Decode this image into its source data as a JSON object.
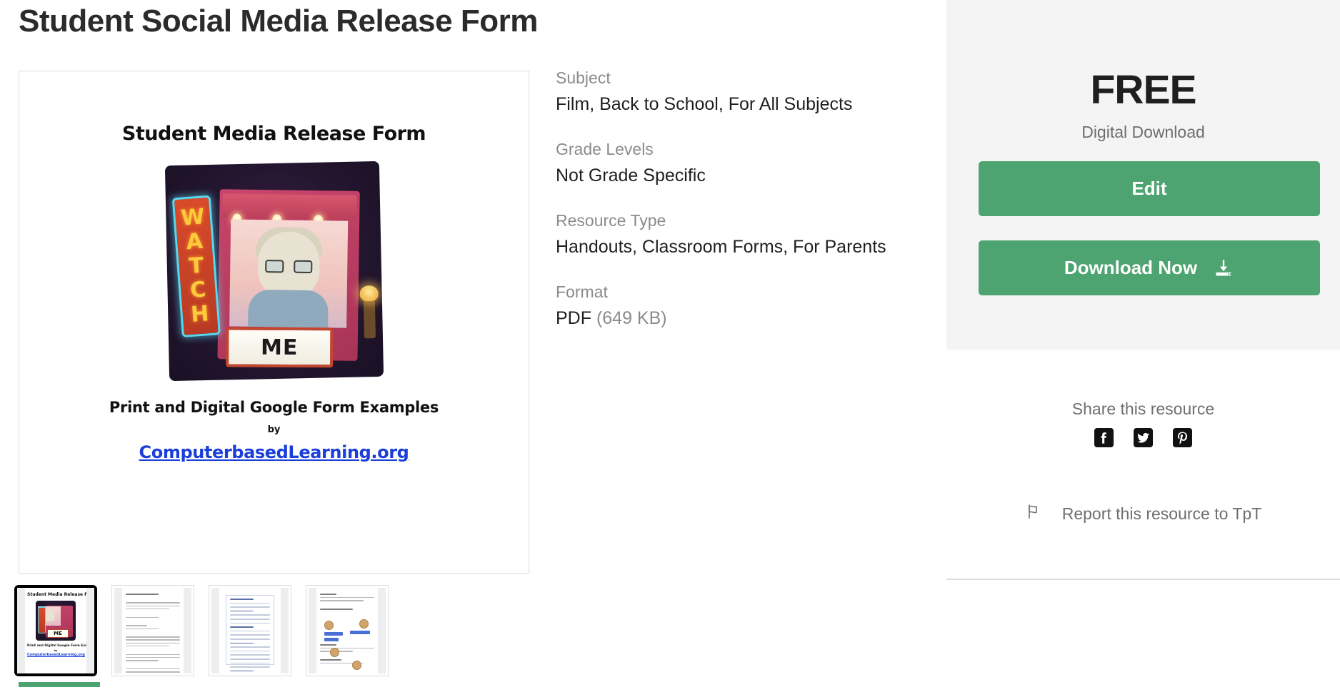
{
  "page_title": "Student Social Media Release Form",
  "preview": {
    "cover_title": "Student Media Release Form",
    "cover_marquee_word": "WATCH",
    "cover_marquee_letters": [
      "W",
      "A",
      "T",
      "C",
      "H"
    ],
    "cover_sign_text": "ME",
    "cover_subtitle": "Print and Digital Google Form Examples",
    "cover_by": "by",
    "cover_link": "ComputerbasedLearning.org"
  },
  "thumbnails": [
    {
      "name": "thumbnail-1-cover",
      "selected": true
    },
    {
      "name": "thumbnail-2-document",
      "selected": false
    },
    {
      "name": "thumbnail-3-google-form",
      "selected": false
    },
    {
      "name": "thumbnail-4-instructions",
      "selected": false
    }
  ],
  "meta": [
    {
      "label": "Subject",
      "value": "Film, Back to School, For All Subjects"
    },
    {
      "label": "Grade Levels",
      "value": "Not Grade Specific"
    },
    {
      "label": "Resource Type",
      "value": "Handouts, Classroom Forms, For Parents"
    }
  ],
  "format": {
    "label": "Format",
    "value": "PDF",
    "size": "(649 KB)"
  },
  "sidebar": {
    "price": "FREE",
    "price_subtitle": "Digital Download",
    "edit_label": "Edit",
    "download_label": "Download Now",
    "share_title": "Share this resource",
    "share_links": [
      {
        "name": "facebook-icon",
        "label": "Facebook"
      },
      {
        "name": "twitter-icon",
        "label": "Twitter"
      },
      {
        "name": "pinterest-icon",
        "label": "Pinterest"
      }
    ],
    "report_label": "Report this resource to TpT"
  },
  "colors": {
    "accent_green": "#4ea470",
    "panel_background": "#f4f4f4",
    "text_primary": "#1f1f1f",
    "text_muted": "#8b8b8b",
    "link_blue": "#1b3fd8"
  }
}
